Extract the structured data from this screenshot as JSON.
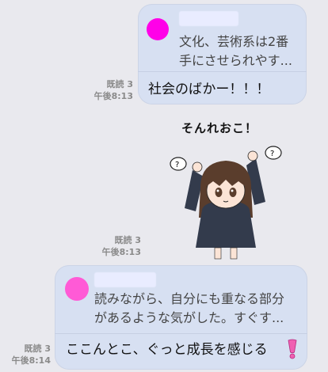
{
  "colors": {
    "background": "#e9e9ee",
    "bubble": "#d7e0f2",
    "avatar_1": "#ff00e8",
    "avatar_2": "#ff5ad6"
  },
  "messages": [
    {
      "quote": "文化、芸術系は2番\n手にさせられやす...",
      "reply": "社会のばかー！！！",
      "read": "既読 3",
      "time": "午後8:13"
    },
    {
      "sticker_caption": "そんれおこ！",
      "read": "既読 3",
      "time": "午後8:13"
    },
    {
      "quote": "読みながら、自分にも重なる部分\nがあるような気がした。すぐす...",
      "reply": "ここんとこ、ぐっと成長を感じる",
      "reply_icon": "pink-exclamation-icon",
      "read": "既読 3",
      "time": "午後8:14"
    }
  ]
}
